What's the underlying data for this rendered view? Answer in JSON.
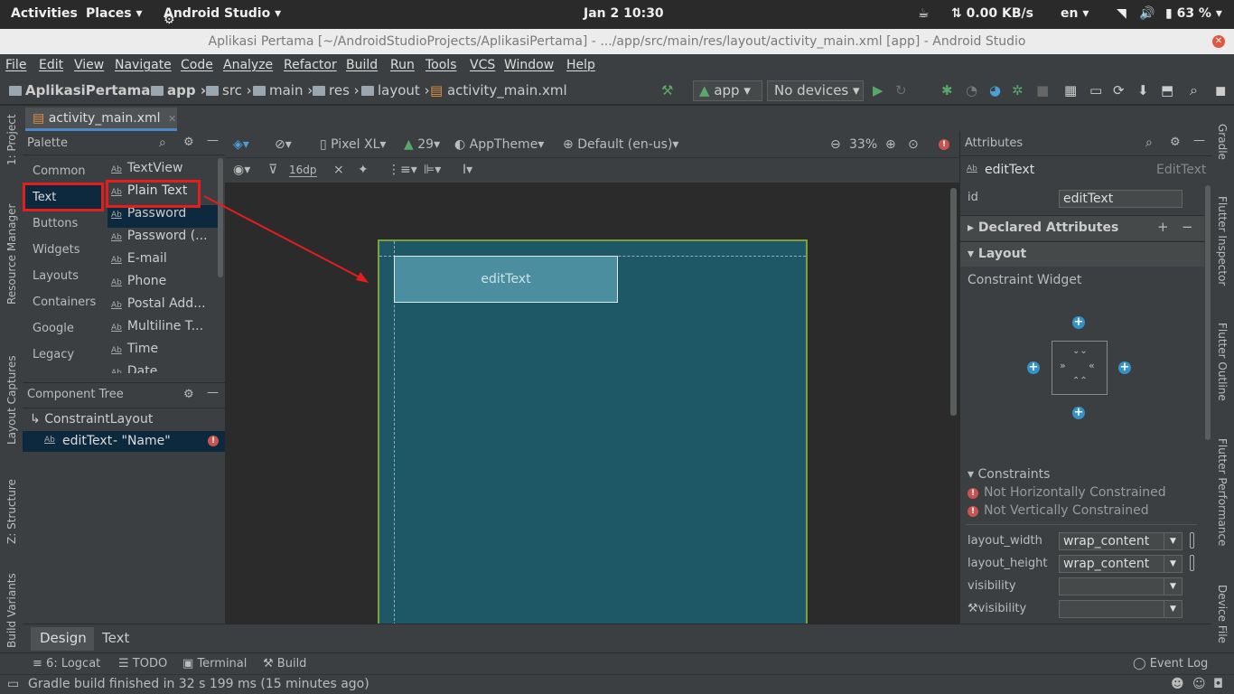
{
  "gnome": {
    "activities": "Activities",
    "places": "Places",
    "app": "Android Studio",
    "clock": "Jan 2  10:30",
    "net": "0.00 KB/s",
    "lang": "en",
    "battery": "63 %"
  },
  "window_title": "Aplikasi Pertama [~/AndroidStudioProjects/AplikasiPertama] - .../app/src/main/res/layout/activity_main.xml [app] - Android Studio",
  "menu": [
    "File",
    "Edit",
    "View",
    "Navigate",
    "Code",
    "Analyze",
    "Refactor",
    "Build",
    "Run",
    "Tools",
    "VCS",
    "Window",
    "Help"
  ],
  "breadcrumb": [
    "AplikasiPertama",
    "app",
    "src",
    "main",
    "res",
    "layout",
    "activity_main.xml"
  ],
  "run_config": "app",
  "device_select": "No devices",
  "file_tab": "activity_main.xml",
  "left_tools": [
    "1: Project",
    "Resource Manager",
    "Layout Captures",
    "Z: Structure",
    "Build Variants"
  ],
  "right_tools": [
    "Gradle",
    "Flutter Inspector",
    "Flutter Outline",
    "Flutter Performance",
    "Device File"
  ],
  "palette": {
    "title": "Palette",
    "categories": [
      "Common",
      "Text",
      "Buttons",
      "Widgets",
      "Layouts",
      "Containers",
      "Google",
      "Legacy"
    ],
    "items": [
      "TextView",
      "Plain Text",
      "Password",
      "Password (...",
      "E-mail",
      "Phone",
      "Postal Add...",
      "Multiline T...",
      "Time",
      "Date"
    ]
  },
  "component_tree": {
    "title": "Component Tree",
    "root": "ConstraintLayout",
    "child": "editText",
    "child_hint": "- \"Name\""
  },
  "design_toolbar": {
    "device": "Pixel XL",
    "api": "29",
    "theme": "AppTheme",
    "locale": "Default (en-us)",
    "zoom": "33%",
    "margin": "16dp"
  },
  "canvas": {
    "edit_text": "editText"
  },
  "attributes": {
    "title": "Attributes",
    "component": "editText",
    "component_type": "EditText",
    "id_label": "id",
    "id_value": "editText",
    "declared": "Declared Attributes",
    "layout": "Layout",
    "constraint_widget": "Constraint Widget",
    "constraints_title": "Constraints",
    "constraint_errors": [
      "Not Horizontally Constrained",
      "Not Vertically Constrained"
    ],
    "fields": [
      {
        "label": "layout_width",
        "value": "wrap_content"
      },
      {
        "label": "layout_height",
        "value": "wrap_content"
      },
      {
        "label": "visibility",
        "value": ""
      },
      {
        "label": "visibility",
        "value": ""
      }
    ]
  },
  "editor_tabs": [
    "Design",
    "Text"
  ],
  "tool_windows": [
    "6: Logcat",
    "TODO",
    "Terminal",
    "Build"
  ],
  "event_log": "Event Log",
  "status": "Gradle build finished in 32 s 199 ms (15 minutes ago)",
  "colors": {
    "accent": "#4a88c7",
    "highlight_box": "#e41d1d",
    "blueprint": "#1e5766",
    "run_green": "#59a869",
    "error": "#c75450"
  }
}
